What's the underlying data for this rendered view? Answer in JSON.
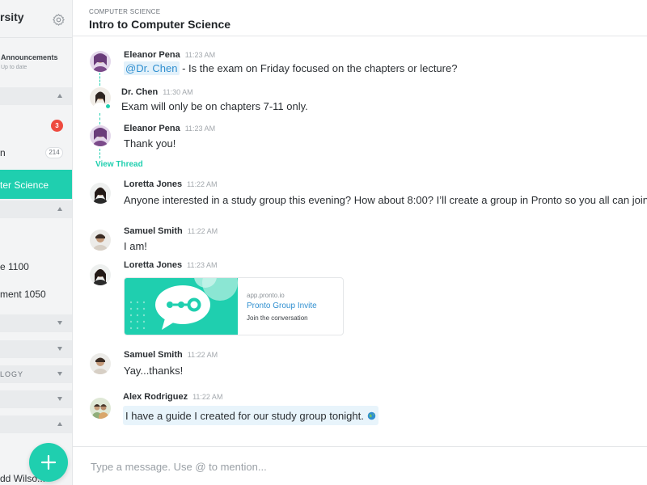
{
  "sidebar": {
    "title": "rsity",
    "announcements": {
      "label": "Announcements",
      "sub": "Up to date"
    },
    "items": [
      {
        "label": "",
        "badge": "3"
      },
      {
        "label": "n",
        "badge": "214"
      }
    ],
    "active_item": "ter Science",
    "courses": [
      "e 1100",
      "ment 1050"
    ],
    "section_label_logy": "LOGY",
    "bottom_user": "dd Wilso..."
  },
  "header": {
    "breadcrumb": "COMPUTER SCIENCE",
    "title": "Intro to Computer Science"
  },
  "messages": [
    {
      "name": "Eleanor Pena",
      "time": "11:23 AM",
      "mention": "@Dr. Chen",
      "text": " - Is the exam on Friday focused on the chapters or lecture?"
    },
    {
      "name": "Dr. Chen",
      "time": "11:30 AM",
      "text": "Exam will only be on chapters 7-11 only."
    },
    {
      "name": "Eleanor Pena",
      "time": "11:23 AM",
      "text": "Thank you!"
    },
    {
      "name": "Loretta Jones",
      "time": "11:22 AM",
      "text": "Anyone interested in a study group this evening? How about 8:00? I’ll create a group in Pronto so you all can join it"
    },
    {
      "name": "Samuel Smith",
      "time": "11:22 AM",
      "text": "I am!"
    },
    {
      "name": "Loretta Jones",
      "time": "11:23 AM",
      "text": ""
    },
    {
      "name": "Samuel Smith",
      "time": "11:22 AM",
      "text": "Yay...thanks!"
    },
    {
      "name": "Alex Rodriguez",
      "time": "11:22 AM",
      "text": "I have a guide I created for our study group tonight."
    }
  ],
  "view_thread": "View Thread",
  "invite_card": {
    "domain": "app.pronto.io",
    "title": "Pronto Group Invite",
    "subtitle": "Join the conversation"
  },
  "composer": {
    "placeholder": "Type a message. Use @ to mention..."
  },
  "colors": {
    "accent": "#1fcfaf",
    "mention_bg": "#e3f1fa",
    "link": "#2f8fd0",
    "badge_red": "#ee4a3f"
  },
  "icons": [
    "gear-icon",
    "chevron-up-icon",
    "chevron-down-icon",
    "plus-icon",
    "globe-icon",
    "chat-bubble-icon"
  ]
}
